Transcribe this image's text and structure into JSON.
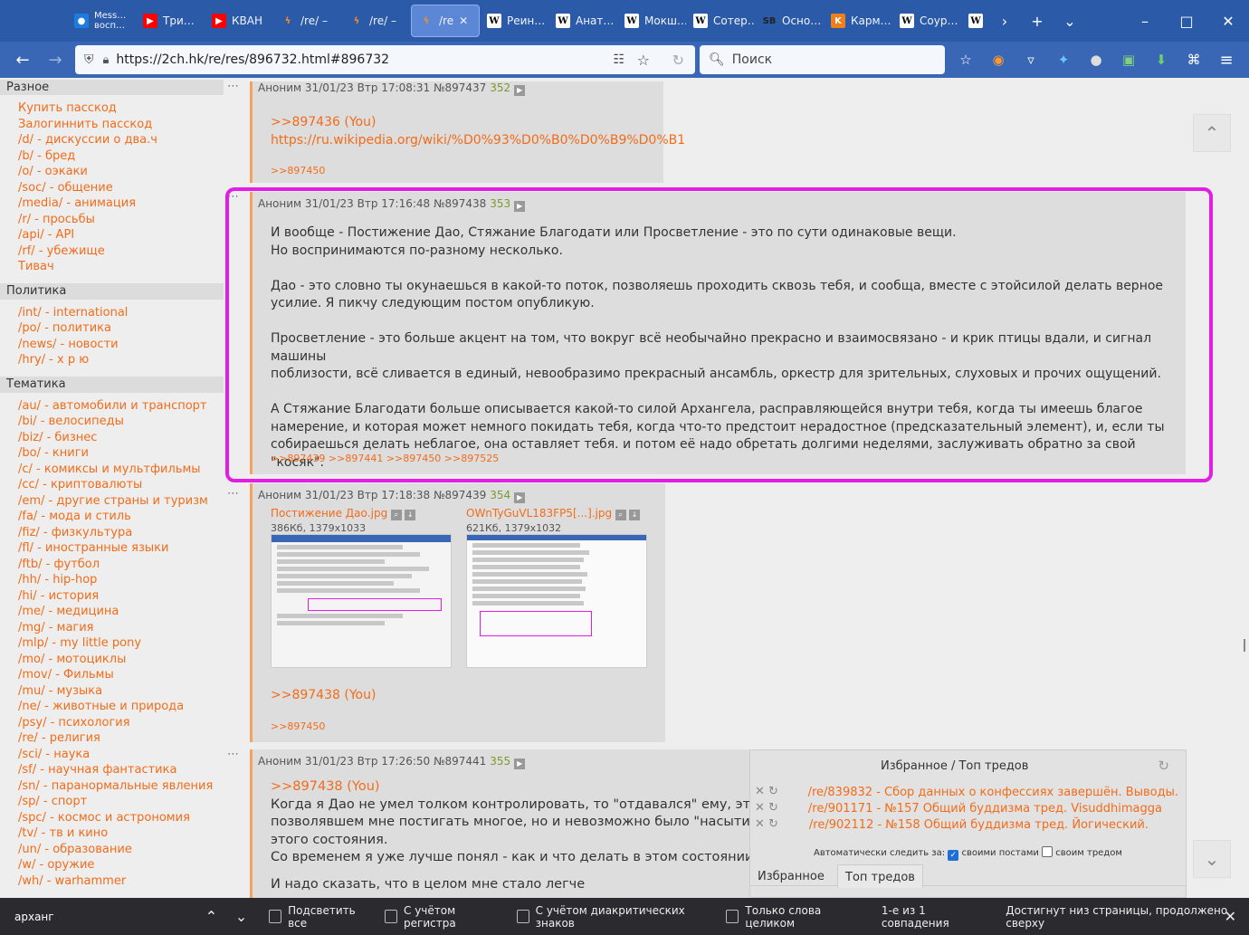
{
  "tabs": [
    {
      "icon": "messenger-icon",
      "label": "Mess… восп…",
      "cls": "ic-m",
      "glyph": "●"
    },
    {
      "icon": "youtube-icon",
      "label": "Три…",
      "cls": "ic-y",
      "glyph": "▶"
    },
    {
      "icon": "youtube-icon",
      "label": "КВАН",
      "cls": "ic-y",
      "glyph": "▶"
    },
    {
      "icon": "bolt-icon",
      "label": "/re/ –",
      "cls": "ic-b",
      "glyph": "ϟ"
    },
    {
      "icon": "bolt-icon",
      "label": "/re/ –",
      "cls": "ic-b",
      "glyph": "ϟ"
    },
    {
      "icon": "bolt-icon",
      "label": "/re",
      "cls": "ic-b",
      "glyph": "ϟ"
    },
    {
      "icon": "wikipedia-icon",
      "label": "Реин…",
      "cls": "ic-w",
      "glyph": "W"
    },
    {
      "icon": "wikipedia-icon",
      "label": "Анат…",
      "cls": "ic-w",
      "glyph": "W"
    },
    {
      "icon": "wikipedia-icon",
      "label": "Мокш…",
      "cls": "ic-w",
      "glyph": "W"
    },
    {
      "icon": "wikipedia-icon",
      "label": "Сотер…",
      "cls": "ic-w",
      "glyph": "W"
    },
    {
      "icon": "sb-icon",
      "label": "Осно…",
      "cls": "ic-sb",
      "glyph": "SB"
    },
    {
      "icon": "k-icon",
      "label": "Карм…",
      "cls": "ic-k",
      "glyph": "K"
    },
    {
      "icon": "wikipedia-icon",
      "label": "Соур…",
      "cls": "ic-w",
      "glyph": "W"
    },
    {
      "icon": "wikipedia-icon",
      "label": "",
      "cls": "ic-w",
      "glyph": "W"
    }
  ],
  "url": "https://2ch.hk/re/res/896732.html#896732",
  "search_placeholder": "Поиск",
  "sidebar": [
    {
      "title": "Разное",
      "items": [
        "Купить пасскод",
        "Залогиннить пасскод",
        "/d/ - дискуссии о два.ч",
        "/b/ - бред",
        "/o/ - оэкаки",
        "/soc/ - общение",
        "/media/ - анимация",
        "/r/ - просьбы",
        "/api/ - API",
        "/rf/ - убежище",
        "Тивач"
      ]
    },
    {
      "title": "Политика",
      "items": [
        "/int/ - international",
        "/po/ - политика",
        "/news/ - новости",
        "/hry/ - х р ю"
      ]
    },
    {
      "title": "Тематика",
      "items": [
        "/au/ - автомобили и транспорт",
        "/bi/ - велосипеды",
        "/biz/ - бизнес",
        "/bo/ - книги",
        "/c/ - комиксы и мультфильмы",
        "/cc/ - криптовалюты",
        "/em/ - другие страны и туризм",
        "/fa/ - мода и стиль",
        "/fiz/ - физкультура",
        "/fl/ - иностранные языки",
        "/ftb/ - футбол",
        "/hh/ - hip-hop",
        "/hi/ - история",
        "/me/ - медицина",
        "/mg/ - магия",
        "/mlp/ - my little pony",
        "/mo/ - мотоциклы",
        "/mov/ - Фильмы",
        "/mu/ - музыка",
        "/ne/ - животные и природа",
        "/psy/ - психология",
        "/re/ - религия",
        "/sci/ - наука",
        "/sf/ - научная фантастика",
        "/sn/ - паранормальные явления",
        "/sp/ - спорт",
        "/spc/ - космос и астрономия",
        "/tv/ - тв и кино",
        "/un/ - образование",
        "/w/ - оружие",
        "/wh/ - warhammer"
      ]
    }
  ],
  "posts": [
    {
      "header": "Аноним 31/01/23 Втр 17:08:31 №897437",
      "num": "352",
      "reply": ">>897436 (You)",
      "link": "https://ru.wikipedia.org/wiki/%D0%93%D0%B0%D0%B9%D0%B1",
      "replies": ">>897450"
    },
    {
      "header": "Аноним 31/01/23 Втр 17:16:48 №897438",
      "num": "353",
      "paragraphs": [
        "И вообще - Постижение Дао, Стяжание Благодати или Просветление - это по сути одинаковые вещи.\nНо воспринимаются по-разному несколько.",
        "Дао - это словно ты окунаешься в какой-то поток, позволяешь проходить сквозь тебя, и сообща, вместе с этойсилой делать верное\nусилие. Я пикчу следующим постом опубликую.",
        "Просветление - это больше акцент на том, что вокруг всё необычайно прекрасно и взаимосвязано - и крик птицы вдали, и сигнал машины\nпоблизости, всё сливается в единый, невообразимо прекрасный ансамбль, оркестр для зрительных, слуховых и прочих ощущений.",
        "А Стяжание Благодати больше описывается какой-то силой Архангела, расправляющейся внутри тебя, когда ты имеешь благое\nнамерение, и которая может немного покидать тебя, когда что-то предстоит нерадостное (предсказательный элемент), и, если ты\nсобираешься делать неблагое, она оставляет тебя. и потом её надо обретать долгими неделями, заслуживать обратно за свой \"косяк\"."
      ],
      "replies": ">>897439 >>897441 >>897450 >>897525"
    },
    {
      "header": "Аноним 31/01/23 Втр 17:18:38 №897439",
      "num": "354",
      "files": [
        {
          "name": "Постижение Дао.jpg",
          "meta": "386Кб, 1379x1033"
        },
        {
          "name": "OWnTyGuVL183FP5[...].jpg",
          "meta": "621Кб, 1379x1032"
        }
      ],
      "reply": ">>897438 (You)",
      "replies": ">>897450"
    },
    {
      "header": "Аноним 31/01/23 Втр 17:26:50 №897441",
      "num": "355",
      "reply": ">>897438 (You)",
      "lines": [
        "Когда я Дао не умел толком контролировать, то \"отдавался\" ему, этому по",
        "позволявшем мне постигать многое, но и невозможно было \"насытиться\", и",
        "этого состояния.",
        "Со временем я уже лучше понял - как и что делать в этом состоянии.",
        "И надо сказать, что в целом мне стало легче"
      ]
    }
  ],
  "favorites": {
    "title": "Избранное / Топ тредов",
    "items": [
      "/re/839832 - Сбор данных о конфессиях завершён. Выводы.",
      "/re/901171 - №157 Общий буддизма тред. Visuddhimagga",
      "/re/902112 - №158 Общий буддизма тред. Йогический."
    ],
    "auto_label": "Автоматически следить за:",
    "own_posts": "своими постами",
    "own_thread": "своим тредом",
    "tab1": "Избранное",
    "tab2": "Топ тредов"
  },
  "findbar": {
    "query": "арханг",
    "highlight_all": "Подсветить все",
    "match_case": "С учётом регистра",
    "diacritics": "С учётом диакритических знаков",
    "whole_words": "Только слова целиком",
    "status": "1-е из 1 совпадения",
    "note": "Достигнут низ страницы, продолжено сверху"
  },
  "colors": {
    "accent": "#f26c1a",
    "highlight": "#e21ee5",
    "tabbar": "#2b5aa8"
  }
}
